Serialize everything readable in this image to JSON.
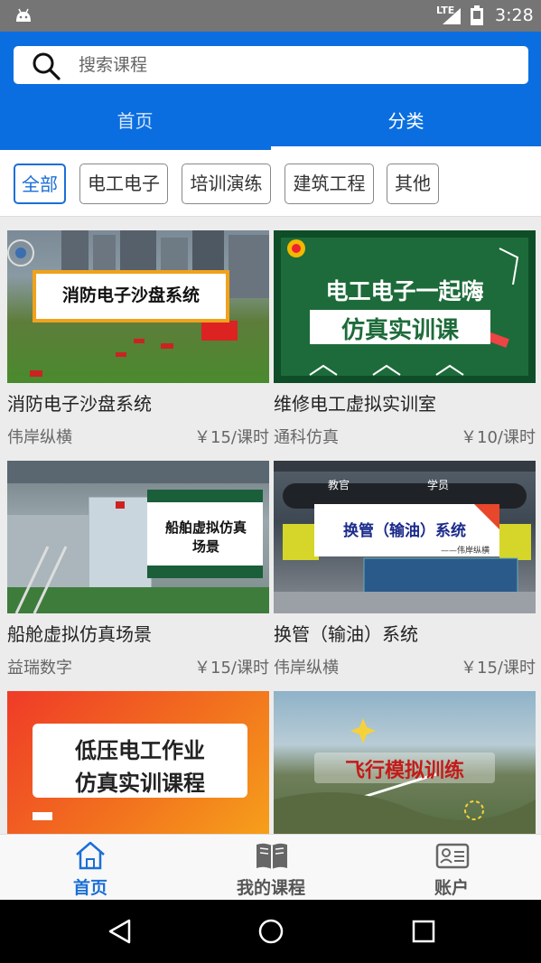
{
  "status_bar": {
    "network": "LTE",
    "time": "3:28"
  },
  "search": {
    "placeholder": "搜索课程"
  },
  "tabs": [
    {
      "label": "首页"
    },
    {
      "label": "分类"
    }
  ],
  "filters": [
    {
      "label": "全部",
      "active": true
    },
    {
      "label": "电工电子"
    },
    {
      "label": "培训演练"
    },
    {
      "label": "建筑工程"
    },
    {
      "label": "其他"
    }
  ],
  "courses": [
    {
      "title": "消防电子沙盘系统",
      "provider": "伟岸纵横",
      "price": "￥15/课时",
      "thumb_text": "消防电子沙盘系统"
    },
    {
      "title": "维修电工虚拟实训室",
      "provider": "通科仿真",
      "price": "￥10/课时",
      "thumb_line1": "电工电子一起嗨",
      "thumb_line2": "仿真实训课"
    },
    {
      "title": "船舱虚拟仿真场景",
      "provider": "益瑞数字",
      "price": "￥15/课时",
      "thumb_line1": "船舶虚拟仿真",
      "thumb_line2": "场景"
    },
    {
      "title": "换管（输油）系统",
      "provider": "伟岸纵横",
      "price": "￥15/课时",
      "thumb_text": "换管（输油）系统",
      "thumb_sub": "——伟岸纵横",
      "thumb_left_label": "教官",
      "thumb_right_label": "学员"
    },
    {
      "thumb_line1": "低压电工作业",
      "thumb_line2": "仿真实训课程"
    },
    {
      "thumb_text": "飞行模拟训练"
    }
  ],
  "bottom_nav": [
    {
      "label": "首页",
      "icon": "home-icon",
      "active": true
    },
    {
      "label": "我的课程",
      "icon": "book-icon"
    },
    {
      "label": "账户",
      "icon": "account-card-icon"
    }
  ],
  "colors": {
    "primary": "#0a6ee0",
    "active_chip": "#1a6fd6",
    "status_bar": "#757575"
  }
}
